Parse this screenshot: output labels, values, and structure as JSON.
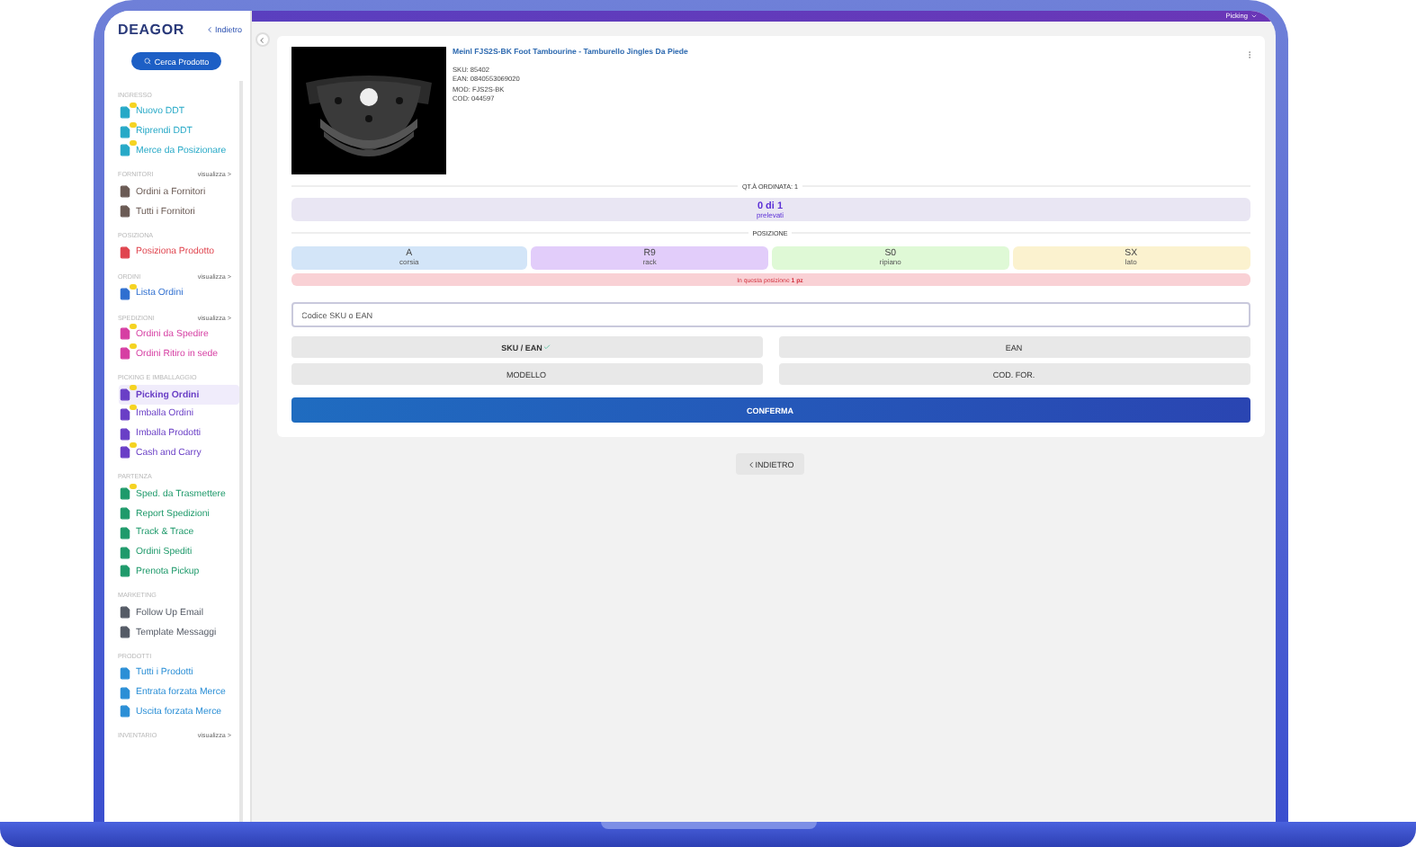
{
  "top_bar": {
    "section": "Picking"
  },
  "sidebar": {
    "logo": "DEAGOR",
    "back_link": "Indietro",
    "search_button": "Cerca Prodotto",
    "sections": [
      {
        "title": "INGRESSO",
        "color": "#27a9c7",
        "items": [
          {
            "label": "Nuovo DDT",
            "badge": true,
            "selected": false
          },
          {
            "label": "Riprendi DDT",
            "badge": true,
            "selected": false
          },
          {
            "label": "Merce da Posizionare",
            "badge": true,
            "selected": false
          }
        ]
      },
      {
        "title": "FORNITORI",
        "color": "#6b5b55",
        "link": "visualizza >",
        "items": [
          {
            "label": "Ordini a Fornitori",
            "badge": false,
            "selected": false
          },
          {
            "label": "Tutti i Fornitori",
            "badge": false,
            "selected": false
          }
        ]
      },
      {
        "title": "POSIZIONA",
        "color": "#e0454f",
        "items": [
          {
            "label": "Posiziona Prodotto",
            "badge": false,
            "selected": false
          }
        ]
      },
      {
        "title": "ORDINI",
        "color": "#2f6fd0",
        "link": "visualizza >",
        "items": [
          {
            "label": "Lista Ordini",
            "badge": true,
            "selected": false
          }
        ]
      },
      {
        "title": "SPEDIZIONI",
        "color": "#d63fa3",
        "link": "visualizza >",
        "items": [
          {
            "label": "Ordini da Spedire",
            "badge": true,
            "selected": false
          },
          {
            "label": "Ordini Ritiro in sede",
            "badge": true,
            "selected": false
          }
        ]
      },
      {
        "title": "PICKING E IMBALLAGGIO",
        "color": "#6a3fc6",
        "items": [
          {
            "label": "Picking Ordini",
            "badge": true,
            "selected": true
          },
          {
            "label": "Imballa Ordini",
            "badge": true,
            "selected": false
          },
          {
            "label": "Imballa Prodotti",
            "badge": false,
            "selected": false
          },
          {
            "label": "Cash and Carry",
            "badge": true,
            "selected": false
          }
        ]
      },
      {
        "title": "PARTENZA",
        "color": "#1f9a6b",
        "items": [
          {
            "label": "Sped. da Trasmettere",
            "badge": true,
            "selected": false
          },
          {
            "label": "Report Spedizioni",
            "badge": false,
            "selected": false
          },
          {
            "label": "Track & Trace",
            "badge": false,
            "selected": false
          },
          {
            "label": "Ordini Spediti",
            "badge": false,
            "selected": false
          },
          {
            "label": "Prenota Pickup",
            "badge": false,
            "selected": false
          }
        ]
      },
      {
        "title": "MARKETING",
        "color": "#555b66",
        "items": [
          {
            "label": "Follow Up Email",
            "badge": false,
            "selected": false
          },
          {
            "label": "Template Messaggi",
            "badge": false,
            "selected": false
          }
        ]
      },
      {
        "title": "PRODOTTI",
        "color": "#2b8fd6",
        "items": [
          {
            "label": "Tutti i Prodotti",
            "badge": false,
            "selected": false
          },
          {
            "label": "Entrata forzata Merce",
            "badge": false,
            "selected": false
          },
          {
            "label": "Uscita forzata Merce",
            "badge": false,
            "selected": false
          }
        ]
      },
      {
        "title": "INVENTARIO",
        "link": "visualizza >"
      }
    ]
  },
  "product": {
    "title": "Meinl FJS2S-BK Foot Tambourine - Tamburello Jingles Da Piede",
    "details": [
      "SKU: 85402",
      "EAN: 0840553069020",
      "MOD: FJS2S-BK",
      "COD: 044597"
    ]
  },
  "quantity": {
    "label": "QT.À ORDINATA: 1",
    "value": "0 di 1",
    "caption": "prelevati"
  },
  "position": {
    "label": "POSIZIONE",
    "cells": [
      {
        "value": "A",
        "caption": "corsia",
        "color": "#d3e5f8"
      },
      {
        "value": "R9",
        "caption": "rack",
        "color": "#e2cdfa"
      },
      {
        "value": "S0",
        "caption": "ripiano",
        "color": "#dff9d6"
      },
      {
        "value": "SX",
        "caption": "lato",
        "color": "#fbf2cf"
      }
    ],
    "notice": "In questa posizione **1 pz**"
  },
  "search": {
    "placeholder": "Codice SKU o EAN"
  },
  "modes": [
    {
      "label": "SKU / EAN",
      "selected": true
    },
    {
      "label": "EAN",
      "selected": false
    },
    {
      "label": "MODELLO",
      "selected": false
    },
    {
      "label": "COD. FOR.",
      "selected": false
    }
  ],
  "confirm_button": "CONFERMA",
  "back_button": "INDIETRO"
}
